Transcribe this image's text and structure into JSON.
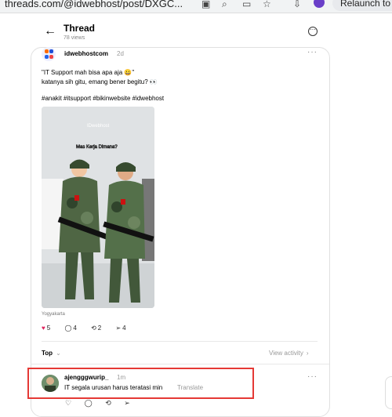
{
  "browser": {
    "url": "threads.com/@idwebhost/post/DXGC...",
    "relaunch": "Relaunch to"
  },
  "header": {
    "title": "Thread",
    "views": "78 views"
  },
  "post": {
    "author": "idwebhostcom",
    "time": "2d",
    "line1": "\"IT Support mah bisa apa aja 😀\"",
    "line2": "katanya sih gitu, emang bener begitu? 👀",
    "hashtags": "#anakit #itsupport #bikinwebsite #idwebhost",
    "media": {
      "watermark": "IDwebhost",
      "caption": "Mas Kerja Dimana?"
    },
    "location": "Yogyakarta",
    "like_count": "5",
    "comment_count": "4",
    "repost_count": "2",
    "share_count": "4"
  },
  "sort": {
    "label": "Top",
    "activity": "View activity"
  },
  "reply": {
    "author": "ajengggwurip_",
    "time": "1m",
    "text": "IT segala urusan harus teratasi min",
    "translate": "Translate"
  }
}
